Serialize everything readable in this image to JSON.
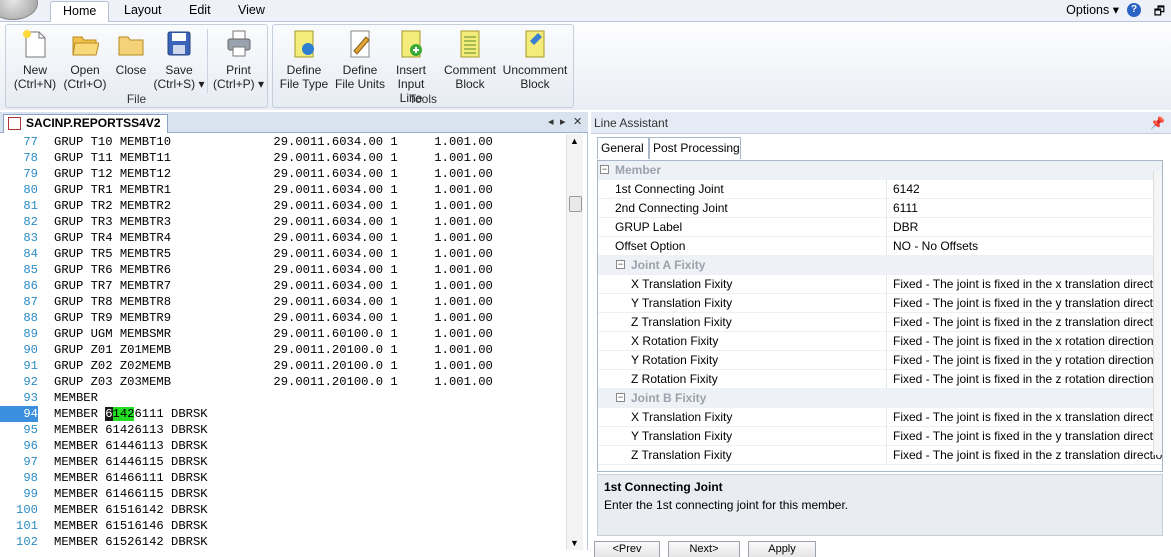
{
  "ribbon_tabs": [
    "Home",
    "Layout",
    "Edit",
    "View"
  ],
  "options_label": "Options",
  "ribbon": {
    "file_group": {
      "label": "File",
      "buttons": [
        {
          "l1": "New",
          "l2": "(Ctrl+N)"
        },
        {
          "l1": "Open",
          "l2": "(Ctrl+O)"
        },
        {
          "l1": "Close",
          "l2": ""
        },
        {
          "l1": "Save",
          "l2": "(Ctrl+S) ▾"
        },
        {
          "l1": "Print",
          "l2": "(Ctrl+P) ▾"
        }
      ]
    },
    "tools_group": {
      "label": "Tools",
      "buttons": [
        {
          "l1": "Define",
          "l2": "File Type"
        },
        {
          "l1": "Define",
          "l2": "File Units"
        },
        {
          "l1": "Insert",
          "l2": "Input Line"
        },
        {
          "l1": "Comment",
          "l2": "Block"
        },
        {
          "l1": "Uncomment",
          "l2": "Block"
        }
      ]
    }
  },
  "document": {
    "tab_title": "SACINP.REPORTSS4V2",
    "controls": {
      "prev": "◂",
      "next": "▸",
      "close": "✕"
    },
    "lines": [
      {
        "n": "77",
        "t": "GRUP T10 MEMBT10              29.0011.6034.00 1     1.001.00"
      },
      {
        "n": "78",
        "t": "GRUP T11 MEMBT11              29.0011.6034.00 1     1.001.00"
      },
      {
        "n": "79",
        "t": "GRUP T12 MEMBT12              29.0011.6034.00 1     1.001.00"
      },
      {
        "n": "80",
        "t": "GRUP TR1 MEMBTR1              29.0011.6034.00 1     1.001.00"
      },
      {
        "n": "81",
        "t": "GRUP TR2 MEMBTR2              29.0011.6034.00 1     1.001.00"
      },
      {
        "n": "82",
        "t": "GRUP TR3 MEMBTR3              29.0011.6034.00 1     1.001.00"
      },
      {
        "n": "83",
        "t": "GRUP TR4 MEMBTR4              29.0011.6034.00 1     1.001.00"
      },
      {
        "n": "84",
        "t": "GRUP TR5 MEMBTR5              29.0011.6034.00 1     1.001.00"
      },
      {
        "n": "85",
        "t": "GRUP TR6 MEMBTR6              29.0011.6034.00 1     1.001.00"
      },
      {
        "n": "86",
        "t": "GRUP TR7 MEMBTR7              29.0011.6034.00 1     1.001.00"
      },
      {
        "n": "87",
        "t": "GRUP TR8 MEMBTR8              29.0011.6034.00 1     1.001.00"
      },
      {
        "n": "88",
        "t": "GRUP TR9 MEMBTR9              29.0011.6034.00 1     1.001.00"
      },
      {
        "n": "89",
        "t": "GRUP UGM MEMBSMR              29.0011.60100.0 1     1.001.00"
      },
      {
        "n": "90",
        "t": "GRUP Z01 Z01MEMB              29.0011.20100.0 1     1.001.00"
      },
      {
        "n": "91",
        "t": "GRUP Z02 Z02MEMB              29.0011.20100.0 1     1.001.00"
      },
      {
        "n": "92",
        "t": "GRUP Z03 Z03MEMB              29.0011.20100.0 1     1.001.00"
      },
      {
        "n": "93",
        "t": "MEMBER"
      },
      {
        "n": "94",
        "pre": "MEMBER ",
        "h1": "6",
        "h2": "142",
        "post": "6111 DBRSK"
      },
      {
        "n": "95",
        "t": "MEMBER 61426113 DBRSK"
      },
      {
        "n": "96",
        "t": "MEMBER 61446113 DBRSK"
      },
      {
        "n": "97",
        "t": "MEMBER 61446115 DBRSK"
      },
      {
        "n": "98",
        "t": "MEMBER 61466111 DBRSK"
      },
      {
        "n": "99",
        "t": "MEMBER 61466115 DBRSK"
      },
      {
        "n": "100",
        "t": "MEMBER 61516142 DBRSK"
      },
      {
        "n": "101",
        "t": "MEMBER 61516146 DBRSK"
      },
      {
        "n": "102",
        "t": "MEMBER 61526142 DBRSK"
      }
    ]
  },
  "line_assistant": {
    "title": "Line Assistant",
    "pin_icon": "pin-icon",
    "tabs": [
      "General",
      "Post Processing"
    ],
    "rows": [
      {
        "kind": "cat",
        "level": 0,
        "label": "Member"
      },
      {
        "kind": "prop",
        "level": 0,
        "name": "1st Connecting Joint",
        "value": "6142"
      },
      {
        "kind": "prop",
        "level": 0,
        "name": "2nd Connecting Joint",
        "value": "6111"
      },
      {
        "kind": "prop",
        "level": 0,
        "name": "GRUP Label",
        "value": "DBR"
      },
      {
        "kind": "prop",
        "level": 0,
        "name": "Offset Option",
        "value": "NO - No Offsets"
      },
      {
        "kind": "cat",
        "level": 1,
        "label": "Joint A Fixity"
      },
      {
        "kind": "prop",
        "level": 1,
        "name": "X Translation Fixity",
        "value": "Fixed - The joint is fixed in the x translation direction"
      },
      {
        "kind": "prop",
        "level": 1,
        "name": "Y Translation Fixity",
        "value": "Fixed - The joint is fixed in the y translation direction"
      },
      {
        "kind": "prop",
        "level": 1,
        "name": "Z Translation Fixity",
        "value": "Fixed - The joint is fixed in the z translation direction"
      },
      {
        "kind": "prop",
        "level": 1,
        "name": "X Rotation Fixity",
        "value": "Fixed - The joint is fixed in the x rotation direction"
      },
      {
        "kind": "prop",
        "level": 1,
        "name": "Y Rotation Fixity",
        "value": "Fixed - The joint is fixed in the y rotation direction"
      },
      {
        "kind": "prop",
        "level": 1,
        "name": "Z Rotation Fixity",
        "value": "Fixed - The joint is fixed in the z rotation direction"
      },
      {
        "kind": "cat",
        "level": 1,
        "label": "Joint B Fixity"
      },
      {
        "kind": "prop",
        "level": 1,
        "name": "X Translation Fixity",
        "value": "Fixed - The joint is fixed in the x translation direction"
      },
      {
        "kind": "prop",
        "level": 1,
        "name": "Y Translation Fixity",
        "value": "Fixed - The joint is fixed in the y translation direction"
      },
      {
        "kind": "prop",
        "level": 1,
        "name": "Z Translation Fixity",
        "value": "Fixed - The joint is fixed in the z translation direction"
      }
    ],
    "description": {
      "title": "1st Connecting Joint",
      "text": "Enter the 1st connecting joint for this member."
    },
    "buttons": [
      "<Prev",
      "Next>",
      "Apply"
    ]
  }
}
